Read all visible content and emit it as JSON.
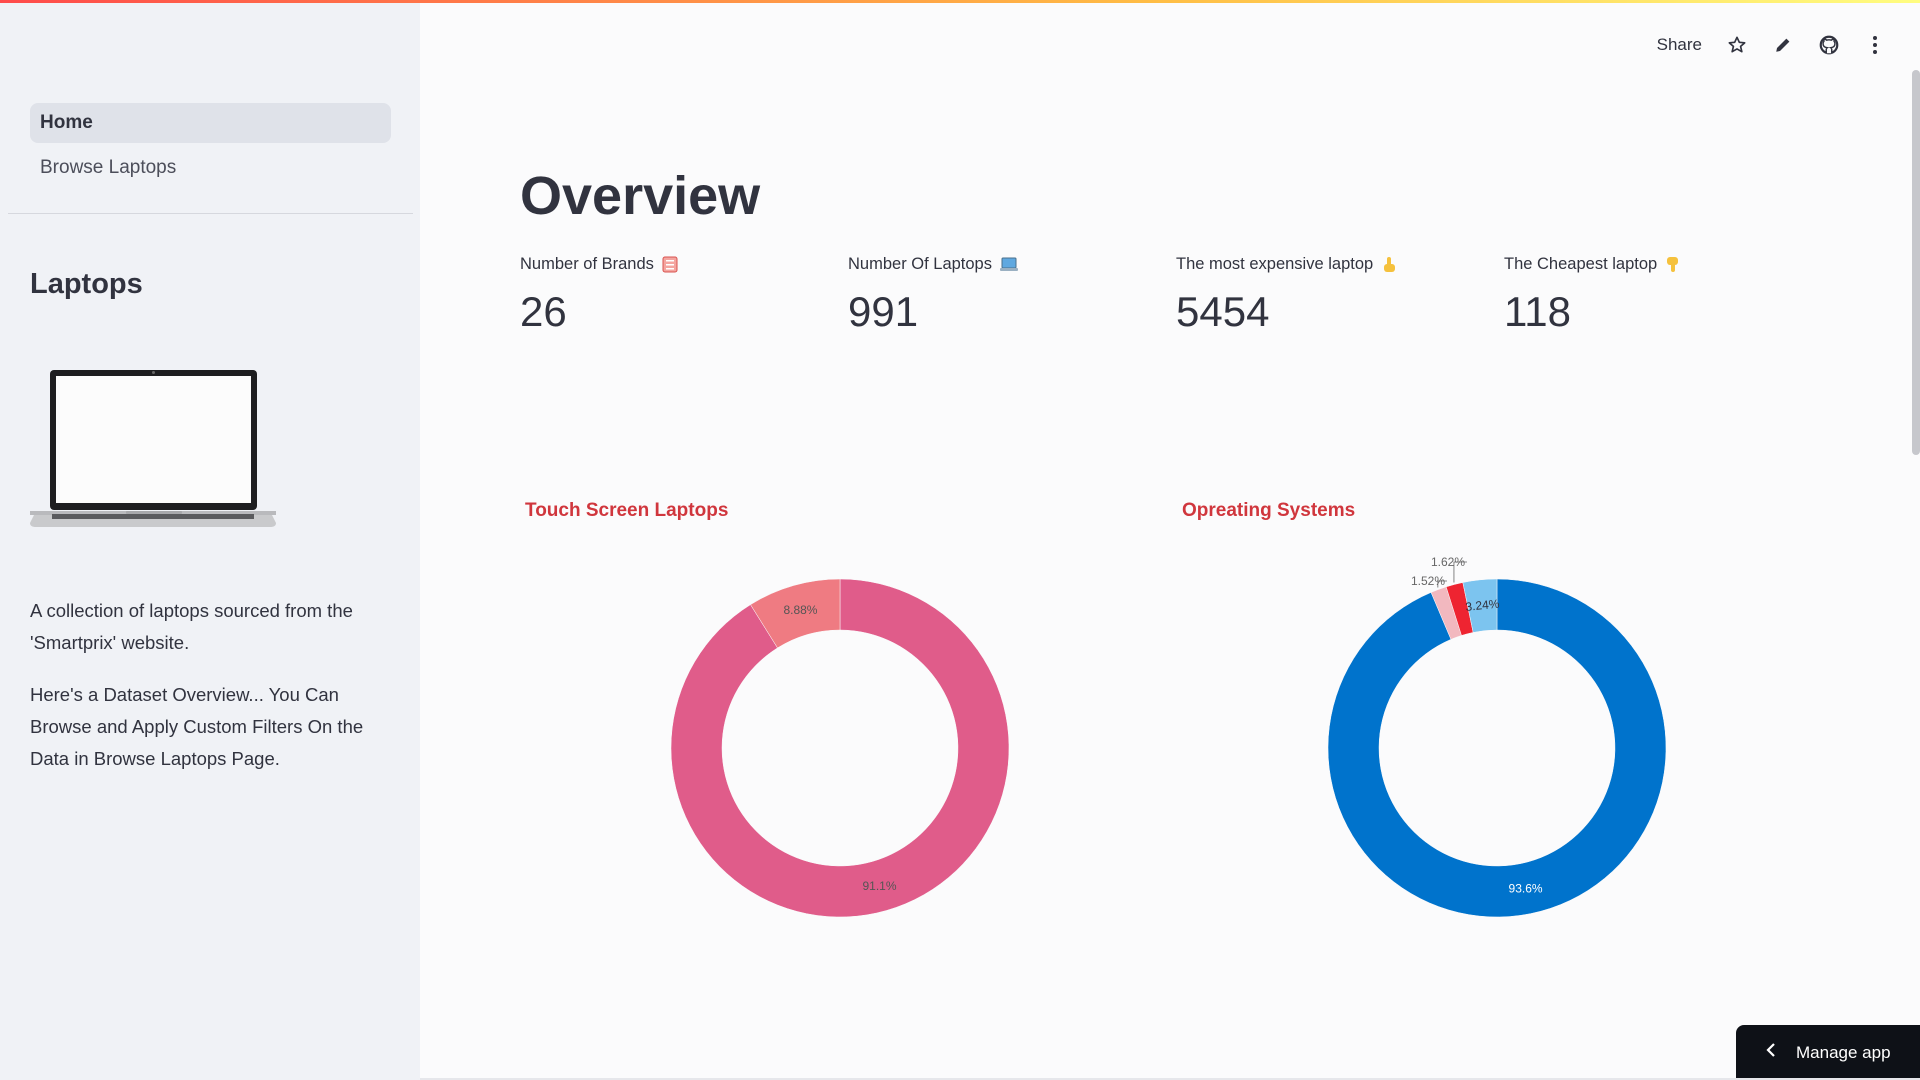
{
  "sidebar": {
    "nav": [
      {
        "label": "Home",
        "active": true
      },
      {
        "label": "Browse Laptops",
        "active": false
      }
    ],
    "heading": "Laptops",
    "paragraphs": [
      "A collection of laptops sourced from the 'Smartprix' website.",
      "Here's a Dataset Overview... You Can Browse and Apply Custom Filters On the Data in Browse Laptops Page."
    ]
  },
  "toolbar": {
    "share_label": "Share",
    "icons": [
      "star-icon",
      "pencil-icon",
      "github-icon",
      "more-vertical-icon"
    ]
  },
  "main": {
    "title": "Overview",
    "metrics": [
      {
        "label": "Number of Brands",
        "value": "26",
        "icon": "ledger-emoji"
      },
      {
        "label": "Number Of Laptops",
        "value": "991",
        "icon": "laptop-emoji"
      },
      {
        "label": "The most expensive laptop",
        "value": "5454",
        "icon": "hand-up-emoji"
      },
      {
        "label": "The Cheapest laptop",
        "value": "118",
        "icon": "hand-down-emoji"
      }
    ]
  },
  "chart_data": [
    {
      "type": "pie",
      "title": "Touch Screen Laptops",
      "hole": true,
      "slices": [
        {
          "label": "91.1%",
          "value": 91.1,
          "color": "#e05c8a"
        },
        {
          "label": "8.88%",
          "value": 8.88,
          "color": "#ef7b82"
        }
      ]
    },
    {
      "type": "pie",
      "title": "Opreating Systems",
      "hole": true,
      "slices": [
        {
          "label": "93.6%",
          "value": 93.6,
          "color": "#0073cc"
        },
        {
          "label": "1.52%",
          "value": 1.52,
          "color": "#f2b8bf"
        },
        {
          "label": "1.62%",
          "value": 1.62,
          "color": "#ee2431"
        },
        {
          "label": "3.24%",
          "value": 3.24,
          "color": "#7cc4ef"
        }
      ]
    }
  ],
  "footer": {
    "manage_label": "Manage app"
  }
}
